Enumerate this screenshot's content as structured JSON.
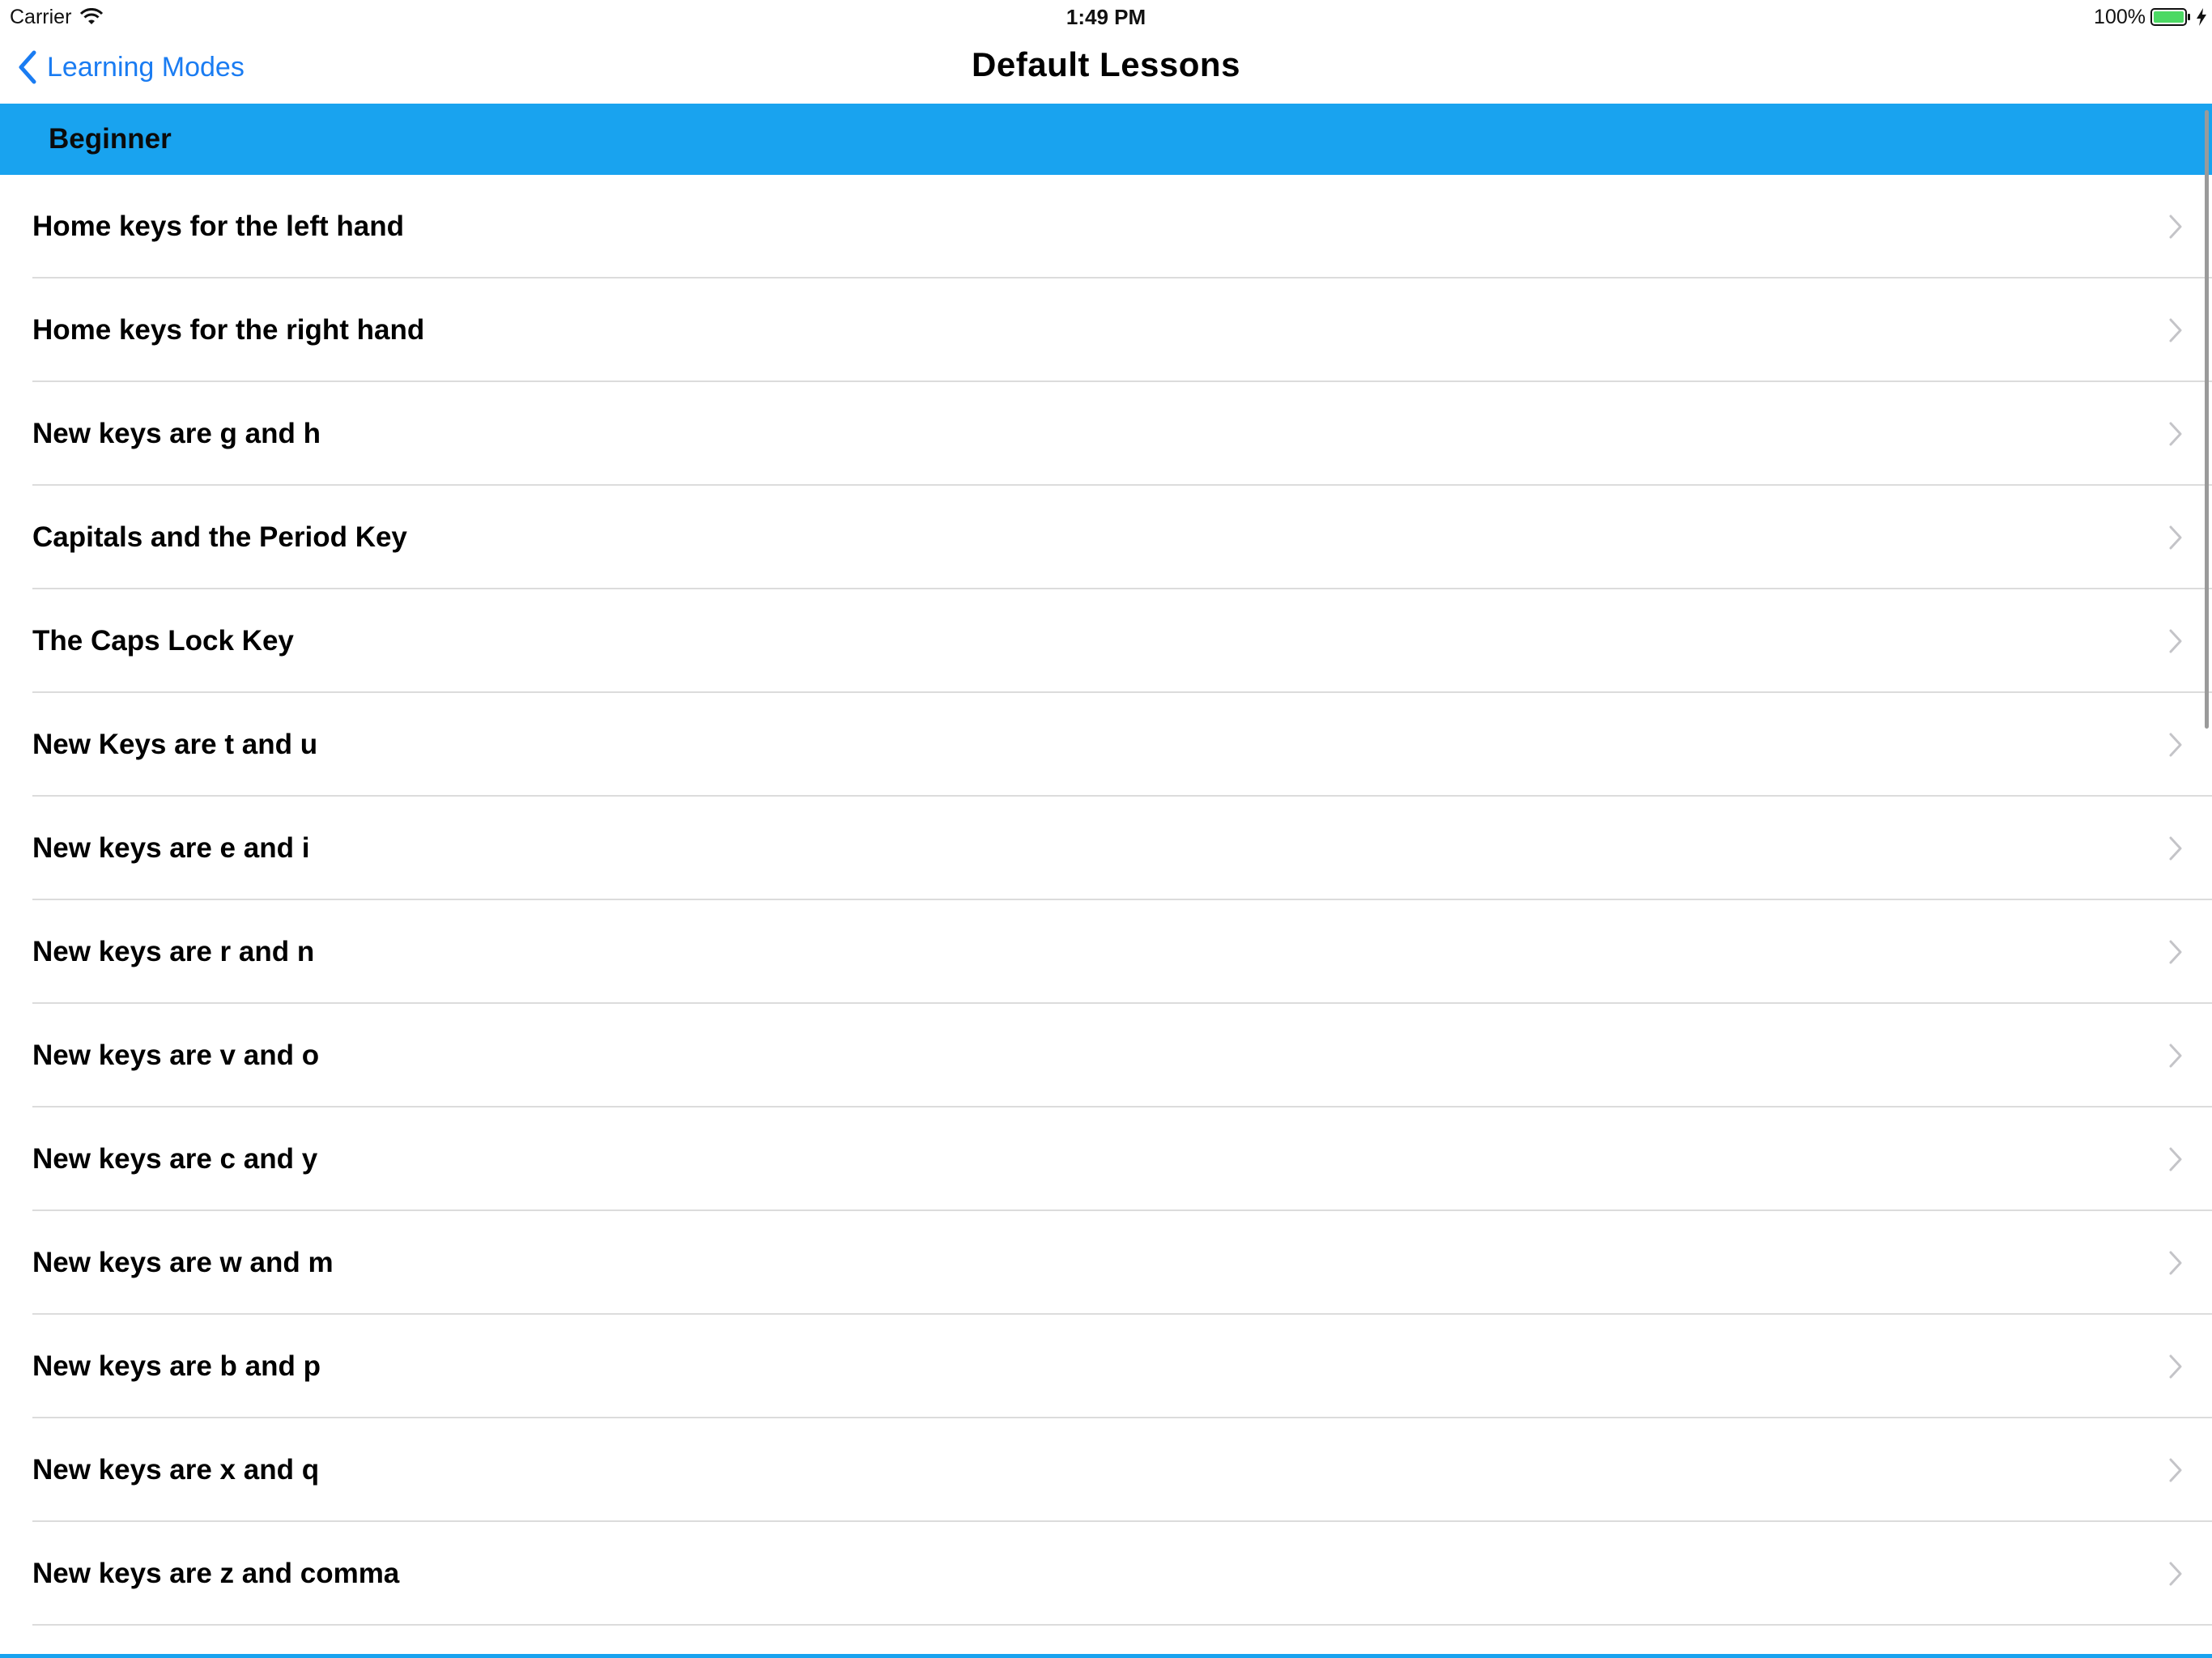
{
  "status_bar": {
    "carrier": "Carrier",
    "time": "1:49 PM",
    "battery_percent": "100%"
  },
  "nav": {
    "back_label": "Learning Modes",
    "title": "Default Lessons"
  },
  "section": {
    "title": "Beginner"
  },
  "lessons": [
    "Home keys for the left hand",
    "Home keys for the right hand",
    "New keys are g and h",
    "Capitals and the Period Key",
    "The Caps Lock Key",
    "New Keys are t and u",
    "New keys are e and i",
    "New keys are r and n",
    "New keys are v and o",
    "New keys are c and y",
    "New keys are w and m",
    "New keys are b and p",
    "New keys are x and q",
    "New keys are z and comma"
  ],
  "colors": {
    "accent": "#19a3ef",
    "link": "#1a7cf2",
    "battery": "#4cd964"
  }
}
